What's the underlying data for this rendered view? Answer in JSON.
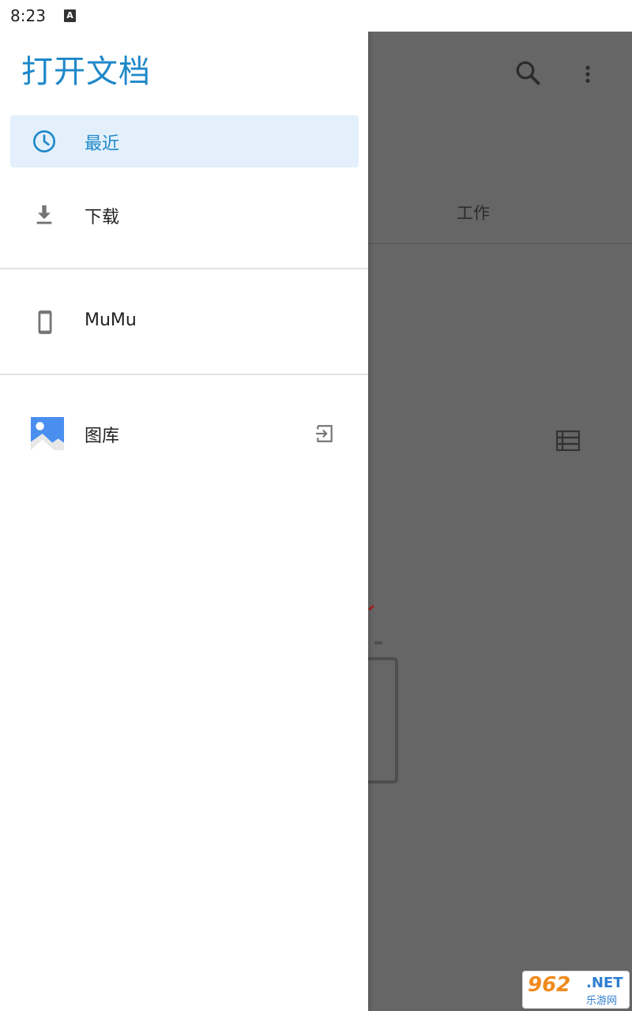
{
  "status_bar": {
    "time": "8:23",
    "notification_icon": "text-a-icon",
    "notification_letter": "A"
  },
  "drawer": {
    "title": "打开文档",
    "items": [
      {
        "label": "最近",
        "icon": "clock-icon",
        "selected": true
      },
      {
        "label": "下载",
        "icon": "download-icon",
        "selected": false
      },
      {
        "label": "MuMu",
        "icon": "phone-icon",
        "selected": false
      },
      {
        "label": "图库",
        "icon": "gallery-icon",
        "selected": false,
        "action_icon": "eject-icon"
      }
    ]
  },
  "background_app": {
    "tab_label": "工作",
    "icons": [
      "search-icon",
      "more-vert-icon",
      "list-view-icon"
    ]
  },
  "watermark": {
    "number": "962",
    "domain": ".NET",
    "subtitle": "乐游网"
  },
  "colors": {
    "accent": "#1e88c9",
    "selected_bg": "#e3f0fb",
    "scrim": "#666666",
    "icon_gray": "#757575"
  }
}
